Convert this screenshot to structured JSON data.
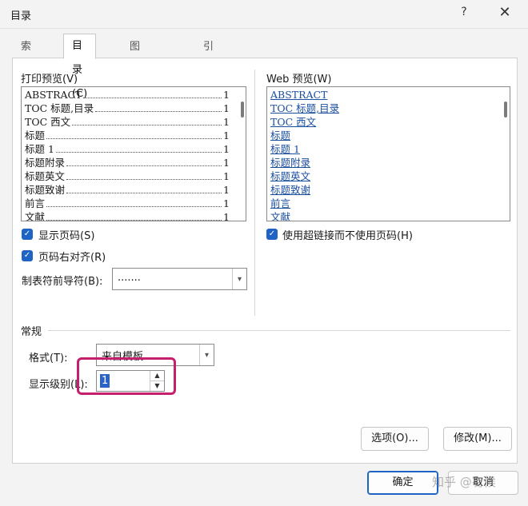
{
  "window": {
    "title": "目录",
    "help": "?",
    "close": "✕"
  },
  "tabs": [
    {
      "label": "索引(X)"
    },
    {
      "label": "目录(C)"
    },
    {
      "label": "图表目录(F)"
    },
    {
      "label": "引文目录(A)"
    }
  ],
  "print_preview": {
    "label": "打印预览(V)",
    "rows": [
      {
        "text": "ABSTRACT",
        "page": "1"
      },
      {
        "text": "TOC 标题,目录",
        "page": "1"
      },
      {
        "text": "TOC 西文",
        "page": "1"
      },
      {
        "text": "标题",
        "page": "1"
      },
      {
        "text": "标题 1",
        "page": "1"
      },
      {
        "text": "标题附录",
        "page": "1"
      },
      {
        "text": "标题英文",
        "page": "1"
      },
      {
        "text": "标题致谢",
        "page": "1"
      },
      {
        "text": "前言",
        "page": "1"
      },
      {
        "text": "文献",
        "page": "1"
      }
    ]
  },
  "web_preview": {
    "label": "Web 预览(W)",
    "rows": [
      "ABSTRACT",
      "TOC 标题,目录",
      "TOC 西文",
      "标题",
      "标题 1",
      "标题附录",
      "标题英文",
      "标题致谢",
      "前言",
      "文献"
    ]
  },
  "options": {
    "show_page_numbers": "显示页码(S)",
    "right_align": "页码右对齐(R)",
    "tab_leader_label": "制表符前导符(B):",
    "tab_leader_value": ".......",
    "use_hyperlinks": "使用超链接而不使用页码(H)"
  },
  "general": {
    "heading": "常规",
    "format_label": "格式(T):",
    "format_value": "来自模板",
    "levels_label": "显示级别(L):",
    "levels_value": "1"
  },
  "buttons": {
    "options": "选项(O)...",
    "modify": "修改(M)...",
    "ok": "确定",
    "cancel": "取消"
  },
  "watermark": "知乎 @有候",
  "colors": {
    "accent": "#1f63c5",
    "highlight": "#c5206e",
    "link": "#1a4fa0"
  }
}
